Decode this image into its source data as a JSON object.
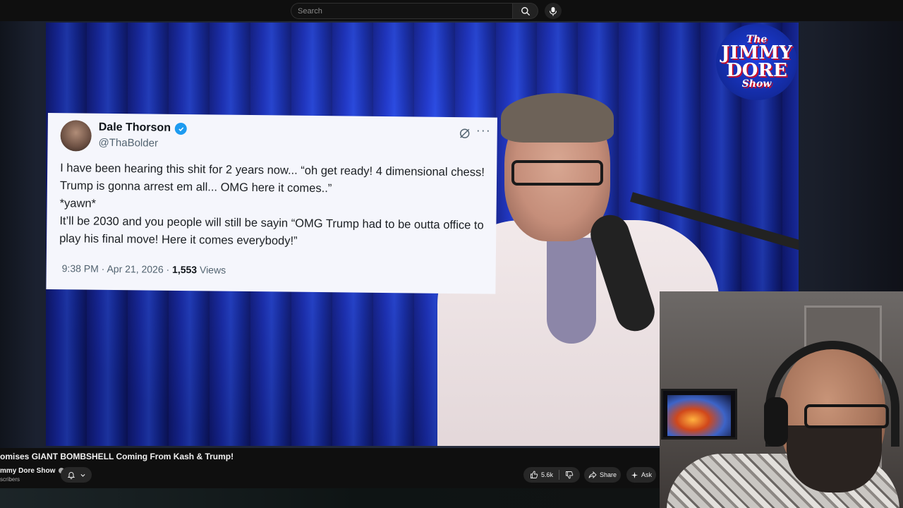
{
  "search": {
    "placeholder": "Search"
  },
  "tweet": {
    "name": "Dale Thorson",
    "handle": "@ThaBolder",
    "text": "I have been hearing this shit for 2 years now... “oh get ready!  4 dimensional chess!  Trump is gonna arrest em all... OMG here it comes..”\n*yawn*\nIt’ll be 2030 and you people will still be sayin “OMG Trump had to be outta office to play his final move!  Here it comes everybody!”",
    "time": "9:38 PM · Apr 21, 2026 · ",
    "views_count": "1,553",
    "views_label": " Views"
  },
  "logo": {
    "line1": "The",
    "line2": "JIMMY",
    "line3": "DORE",
    "line4": "Show"
  },
  "video": {
    "title": "omises GIANT BOMBSHELL Coming From Kash & Trump!",
    "channel": "mmy Dore Show",
    "subscribers": "scribers"
  },
  "actions": {
    "likes": "5.6k",
    "share": "Share",
    "ask": "Ask"
  },
  "colors": {
    "accent_blue": "#1d9bf0",
    "pill_bg": "#272727",
    "page_bg": "#0f0f0f"
  }
}
